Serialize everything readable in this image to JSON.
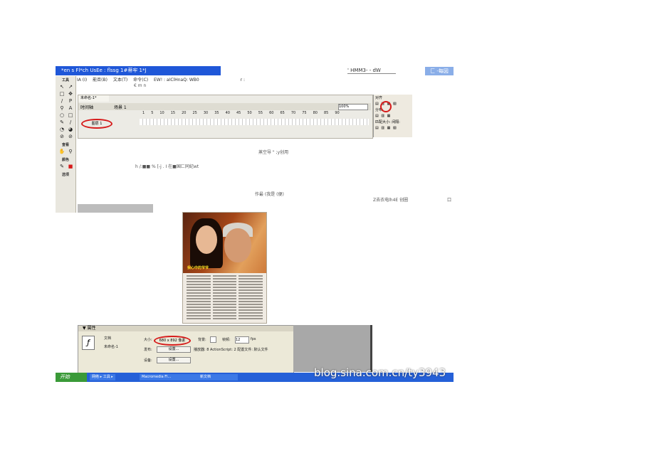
{
  "window": {
    "title": "*en s Fl*ch UsEe : flssg 1#蒂牢 1*J",
    "title_right": "' HMM3- - dW",
    "close_chip": "匚 -每図"
  },
  "menubar": {
    "items": [
      "IA (I)",
      "能否(B)",
      "文本(T)",
      "命令(C)",
      "EW! : aIClHnaQ: WB0"
    ],
    "fragment": "r :"
  },
  "toolbar": {
    "text": "€ m n"
  },
  "toolbox": {
    "head_tools": "工具",
    "head_view": "查看",
    "head_color": "颜色",
    "head_options": "选项",
    "tools": [
      "↖",
      "↗",
      "□",
      "✥",
      "/",
      "P",
      "⚲",
      "A",
      "○",
      "□",
      "✎",
      "/",
      "◔",
      "◕",
      "⊘",
      "⊘"
    ]
  },
  "timeline": {
    "doc_tab": "未命名-1*",
    "timeline_button": "时间轴",
    "scene_label": "场景 1",
    "zoom_value": "100%",
    "layer_name": "图层 1",
    "frame_numbers": [
      "1",
      "5",
      "10",
      "15",
      "20",
      "25",
      "30",
      "35",
      "40",
      "45",
      "50",
      "55",
      "60",
      "65",
      "70",
      "75",
      "80",
      "85",
      "90"
    ]
  },
  "align_panel": {
    "head": "对齐",
    "row1": "▤ ▥ ▦ ▧",
    "head2": "分布:",
    "row2": "▤ ▥ ▦",
    "head3": "匹配大小: 间隔:",
    "row3": "▤ ▥ ▦ ▧"
  },
  "stage_texts": {
    "line1": "蒸空导 \"          ;y创用",
    "line2": "h /:■■ % [-j . I 在■国匚同纪wt",
    "line3": "作最                   (我是      (便)",
    "line4": "Z去衣电lh4E 创圈",
    "line5": "口"
  },
  "photo": {
    "caption": "我心中的爷爷"
  },
  "properties": {
    "panel_title": "▼ 属性",
    "doc_label": "文档",
    "doc_name": "未命名-1",
    "size_label": "大小:",
    "size_value": "680 x 892 像素",
    "bg_label": "背景:",
    "fps_label": "帧频:",
    "fps_value": "12",
    "fps_unit": "fps",
    "publish_label": "发布:",
    "publish_button": "设置...",
    "player_text": "播放器: 8  ActionScript: 2  配置文件: 默认文件",
    "device_label": "设备:",
    "device_button": "设置..."
  },
  "taskbar": {
    "start_label": "开始",
    "tasks": [
      "网络 ▸ 工具 ▸",
      "Macromedia Fl...",
      "新文档"
    ]
  },
  "watermark": "blog.sina.com.cn/ty3943"
}
